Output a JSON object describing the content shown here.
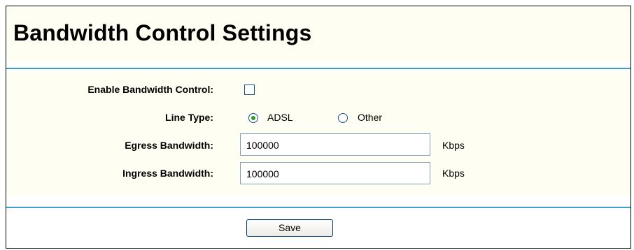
{
  "page": {
    "title": "Bandwidth Control Settings"
  },
  "form": {
    "enable": {
      "label": "Enable Bandwidth Control:",
      "checked": false
    },
    "line_type": {
      "label": "Line Type:",
      "options": [
        "ADSL",
        "Other"
      ],
      "selected": "ADSL"
    },
    "egress": {
      "label": "Egress Bandwidth:",
      "value": "100000",
      "unit": "Kbps"
    },
    "ingress": {
      "label": "Ingress Bandwidth:",
      "value": "100000",
      "unit": "Kbps"
    }
  },
  "actions": {
    "save_label": "Save"
  },
  "colors": {
    "accent_rule": "#3d9ec9",
    "panel_background": "#fffef2",
    "radio_selected": "#2d9a2d"
  }
}
